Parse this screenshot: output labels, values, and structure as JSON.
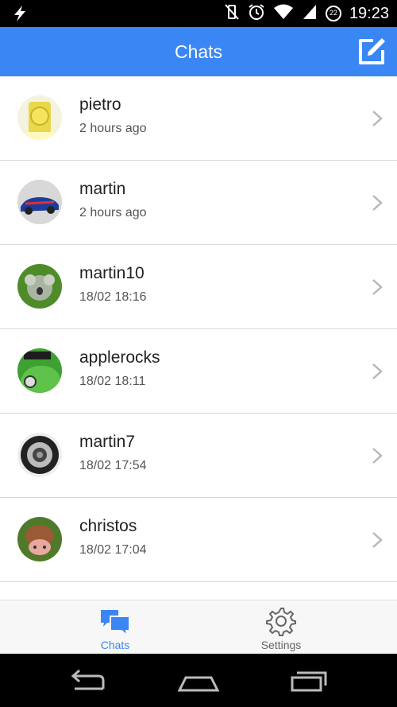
{
  "status_bar": {
    "time": "19:23",
    "battery_level": "22",
    "icons": [
      "lightning-icon",
      "vibrate-off-icon",
      "alarm-icon",
      "wifi-icon",
      "signal-icon",
      "battery-icon"
    ]
  },
  "app_bar": {
    "title": "Chats",
    "compose_icon": "compose-icon"
  },
  "chats": [
    {
      "name": "pietro",
      "time": "2 hours ago",
      "avatar": "lemonade"
    },
    {
      "name": "martin",
      "time": "2 hours ago",
      "avatar": "race-car"
    },
    {
      "name": "martin10",
      "time": "18/02 18:16",
      "avatar": "koala"
    },
    {
      "name": "applerocks",
      "time": "18/02 18:11",
      "avatar": "green-car"
    },
    {
      "name": "martin7",
      "time": "18/02 17:54",
      "avatar": "speaker"
    },
    {
      "name": "christos",
      "time": "18/02 17:04",
      "avatar": "cow"
    }
  ],
  "tabs": [
    {
      "label": "Chats",
      "active": true,
      "icon": "chats-icon"
    },
    {
      "label": "Settings",
      "active": false,
      "icon": "gear-icon"
    }
  ],
  "colors": {
    "accent": "#3a86f4",
    "inactive": "#666666"
  }
}
